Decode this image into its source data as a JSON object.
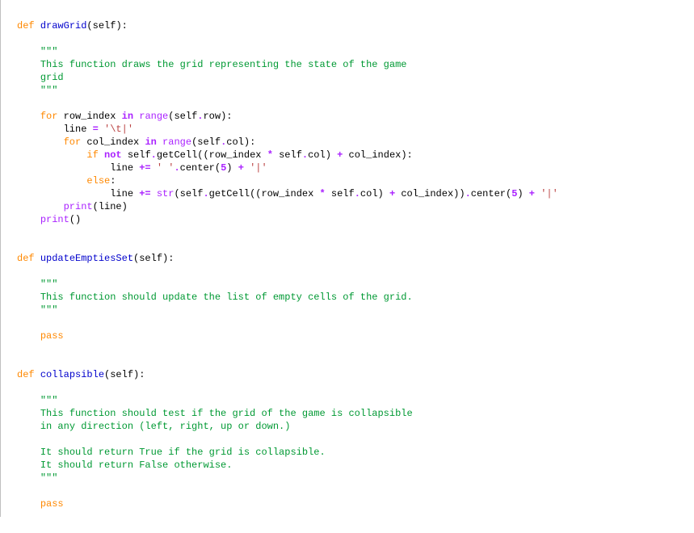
{
  "drawGrid": {
    "def": "def",
    "name": "drawGrid",
    "sig_open": "(",
    "self": "self",
    "sig_close": "):",
    "doc_open": "\"\"\"",
    "doc_line1": "This function draws the grid representing the state of the game",
    "doc_line2": "grid",
    "doc_close": "\"\"\"",
    "for1_kw": "for",
    "for1_var": " row_index ",
    "for1_in": "in",
    "for1_space": " ",
    "for1_range": "range",
    "for1_after": "(self",
    "for1_dot": ".",
    "for1_attr": "row):",
    "line_assign_lhs": "        line ",
    "line_assign_op": "=",
    "line_assign_space": " ",
    "line_assign_rhs": "'\\t|'",
    "for2_indent": "        ",
    "for2_kw": "for",
    "for2_var": " col_index ",
    "for2_in": "in",
    "for2_space": " ",
    "for2_range": "range",
    "for2_after": "(self",
    "for2_dot": ".",
    "for2_attr": "col):",
    "if_indent": "            ",
    "if_kw": "if",
    "if_space": " ",
    "if_not": "not",
    "if_after": " self",
    "if_dot1": ".",
    "if_call": "getCell((row_index ",
    "if_mul": "*",
    "if_after_mul": " self",
    "if_dot2": ".",
    "if_attr2": "col) ",
    "if_plus": "+",
    "if_after_plus": " col_index):",
    "line_plus1_indent": "                line ",
    "line_plus1_op": "+=",
    "line_plus1_space": " ",
    "line_plus1_str1": "' '",
    "line_plus1_dot": ".",
    "line_plus1_center": "center(",
    "line_plus1_five": "5",
    "line_plus1_close": ") ",
    "line_plus1_plus": "+",
    "line_plus1_space2": " ",
    "line_plus1_pipe": "'|'",
    "else_indent": "            ",
    "else_kw": "else",
    "else_colon": ":",
    "line_plus2_indent": "                line ",
    "line_plus2_op": "+=",
    "line_plus2_space": " ",
    "line_plus2_str": "str",
    "line_plus2_open": "(self",
    "line_plus2_dot1": ".",
    "line_plus2_call": "getCell((row_index ",
    "line_plus2_mul": "*",
    "line_plus2_after_mul": " self",
    "line_plus2_dot2": ".",
    "line_plus2_attr": "col) ",
    "line_plus2_plus1": "+",
    "line_plus2_after_plus": " col_index))",
    "line_plus2_dot3": ".",
    "line_plus2_center": "center(",
    "line_plus2_five": "5",
    "line_plus2_close": ") ",
    "line_plus2_plus2": "+",
    "line_plus2_space2": " ",
    "line_plus2_pipe": "'|'",
    "printline_indent": "        ",
    "print1": "print",
    "printline_arg": "(line)",
    "printblank_indent": "    ",
    "print2": "print",
    "print2_arg": "()"
  },
  "updateEmptiesSet": {
    "def": "def",
    "name": "updateEmptiesSet",
    "sig": "(self):",
    "doc_open": "\"\"\"",
    "doc_line1": "This function should update the list of empty cells of the grid.",
    "doc_close": "\"\"\"",
    "pass": "pass"
  },
  "collapsible": {
    "def": "def",
    "name": "collapsible",
    "sig": "(self):",
    "doc_open": "\"\"\"",
    "doc_line1": "This function should test if the grid of the game is collapsible",
    "doc_line2": "in any direction (left, right, up or down.)",
    "doc_line3": "",
    "doc_line4": "It should return True if the grid is collapsible.",
    "doc_line5": "It should return False otherwise.",
    "doc_close": "\"\"\"",
    "pass": "pass"
  }
}
